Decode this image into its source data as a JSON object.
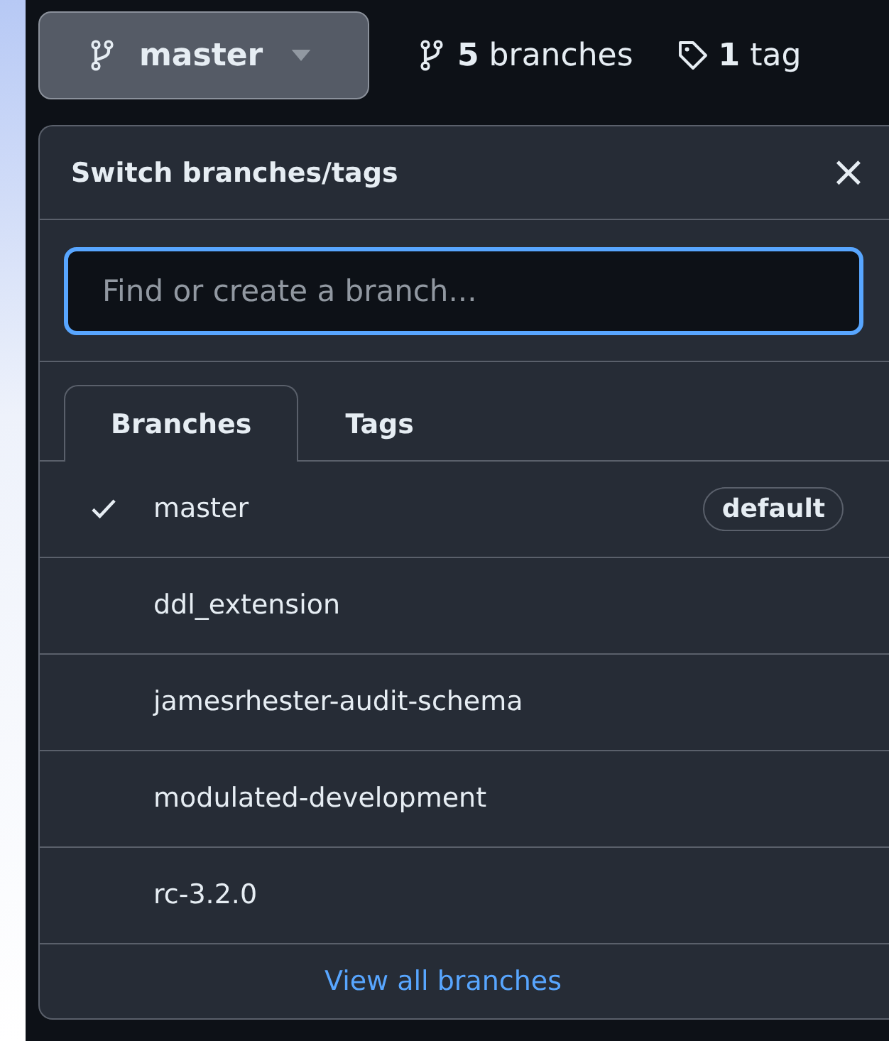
{
  "branch_button": {
    "label": "master"
  },
  "stats": [
    {
      "kind": "branch",
      "count": "5",
      "label": "branches"
    },
    {
      "kind": "tag",
      "count": "1",
      "label": "tag"
    }
  ],
  "dropdown": {
    "title": "Switch branches/tags",
    "close": "×",
    "search": {
      "placeholder": "Find or create a branch...",
      "focused": true
    },
    "tabs": [
      {
        "label": "Branches",
        "selected": true
      },
      {
        "label": "Tags",
        "selected": false
      }
    ],
    "items": [
      {
        "name": "master",
        "checked": true,
        "badge": "default"
      },
      {
        "name": "ddl_extension",
        "checked": false
      },
      {
        "name": "jamesrhester-audit-schema",
        "checked": false
      },
      {
        "name": "modulated-development",
        "checked": false
      },
      {
        "name": "rc-3.2.0",
        "checked": false
      }
    ],
    "footer_link": "View all branches"
  }
}
